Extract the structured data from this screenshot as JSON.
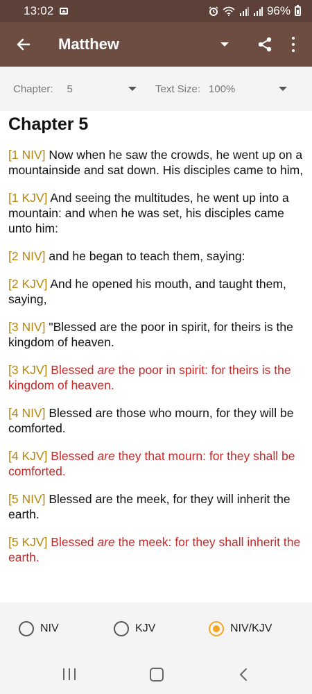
{
  "status_bar": {
    "time": "13:02",
    "battery": "96%"
  },
  "app_bar": {
    "title": "Matthew"
  },
  "settings": {
    "chapter_label": "Chapter:",
    "chapter_value": "5",
    "text_size_label": "Text Size:",
    "text_size_value": "100%"
  },
  "content": {
    "heading": "Chapter 5",
    "verses": [
      {
        "ref": "[1 NIV]",
        "text": " Now when he saw the crowds, he went up on a mountainside and sat down. His disciples came to him,",
        "red": false
      },
      {
        "ref": "[1 KJV]",
        "text": " And seeing the multitudes, he went up into a mountain: and when he was set, his disciples came unto him:",
        "red": false
      },
      {
        "ref": "[2 NIV]",
        "text": " and he began to teach them, saying:",
        "red": false
      },
      {
        "ref": "[2 KJV]",
        "text": " And he opened his mouth, and taught them, saying,",
        "red": false
      },
      {
        "ref": "[3 NIV]",
        "text": " \"Blessed are the poor in spirit, for theirs is the kingdom of heaven.",
        "red": false
      },
      {
        "ref": "[3 KJV]",
        "text_before": " Blessed ",
        "text_italic": "are",
        "text_after": " the poor in spirit: for theirs is the kingdom of heaven.",
        "red": true
      },
      {
        "ref": "[4 NIV]",
        "text": " Blessed are those who mourn, for they will be comforted.",
        "red": false
      },
      {
        "ref": "[4 KJV]",
        "text_before": " Blessed ",
        "text_italic": "are",
        "text_after": " they that mourn: for they shall be comforted.",
        "red": true
      },
      {
        "ref": "[5 NIV]",
        "text": " Blessed are the meek, for they will inherit the earth.",
        "red": false
      },
      {
        "ref": "[5 KJV]",
        "text_before": " Blessed ",
        "text_italic": "are",
        "text_after": " the meek: for they shall inherit the earth.",
        "red": true
      }
    ]
  },
  "version_selector": {
    "options": [
      "NIV",
      "KJV",
      "NIV/KJV"
    ],
    "selected": "NIV/KJV"
  },
  "colors": {
    "status_bar": "#5d4037",
    "app_bar": "#6d4c41",
    "verse_ref": "#b8860b",
    "red_letter": "#c62828",
    "radio_selected": "#f5a623"
  }
}
